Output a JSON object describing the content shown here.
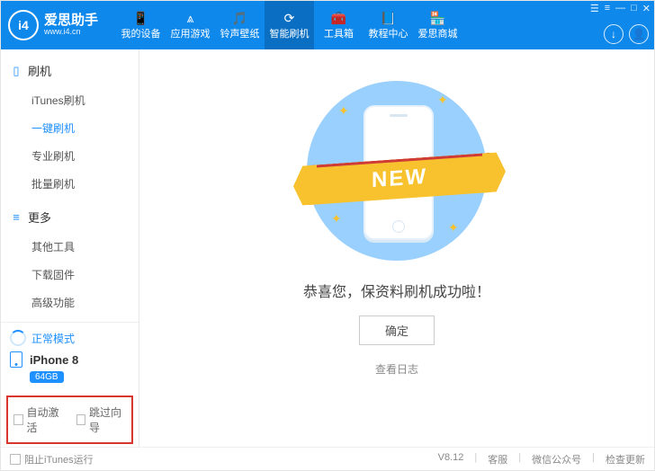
{
  "brand": {
    "name": "爱思助手",
    "url": "www.i4.cn",
    "badge": "i4"
  },
  "window_icons": {
    "a": "☰",
    "b": "≡",
    "c": "—",
    "d": "□",
    "e": "✕"
  },
  "user_icons": {
    "download": "↓",
    "account": "👤"
  },
  "nav": [
    {
      "icon": "📱",
      "label": "我的设备"
    },
    {
      "icon": "⩓",
      "label": "应用游戏"
    },
    {
      "icon": "🎵",
      "label": "铃声壁纸"
    },
    {
      "icon": "⟳",
      "label": "智能刷机"
    },
    {
      "icon": "🧰",
      "label": "工具箱"
    },
    {
      "icon": "📘",
      "label": "教程中心"
    },
    {
      "icon": "🏪",
      "label": "爱思商城"
    }
  ],
  "sidebar": {
    "flash": {
      "title": "刷机",
      "items": [
        "iTunes刷机",
        "一键刷机",
        "专业刷机",
        "批量刷机"
      ]
    },
    "more": {
      "title": "更多",
      "items": [
        "其他工具",
        "下载固件",
        "高级功能"
      ]
    }
  },
  "mode": {
    "label": "正常模式"
  },
  "device": {
    "name": "iPhone 8",
    "capacity": "64GB"
  },
  "options": {
    "auto_activate": "自动激活",
    "skip_guide": "跳过向导"
  },
  "main": {
    "ribbon": "NEW",
    "message": "恭喜您，保资料刷机成功啦！",
    "ok": "确定",
    "log": "查看日志"
  },
  "status": {
    "block": "阻止iTunes运行",
    "version": "V8.12",
    "help": "客服",
    "wechat": "微信公众号",
    "update": "检查更新"
  }
}
